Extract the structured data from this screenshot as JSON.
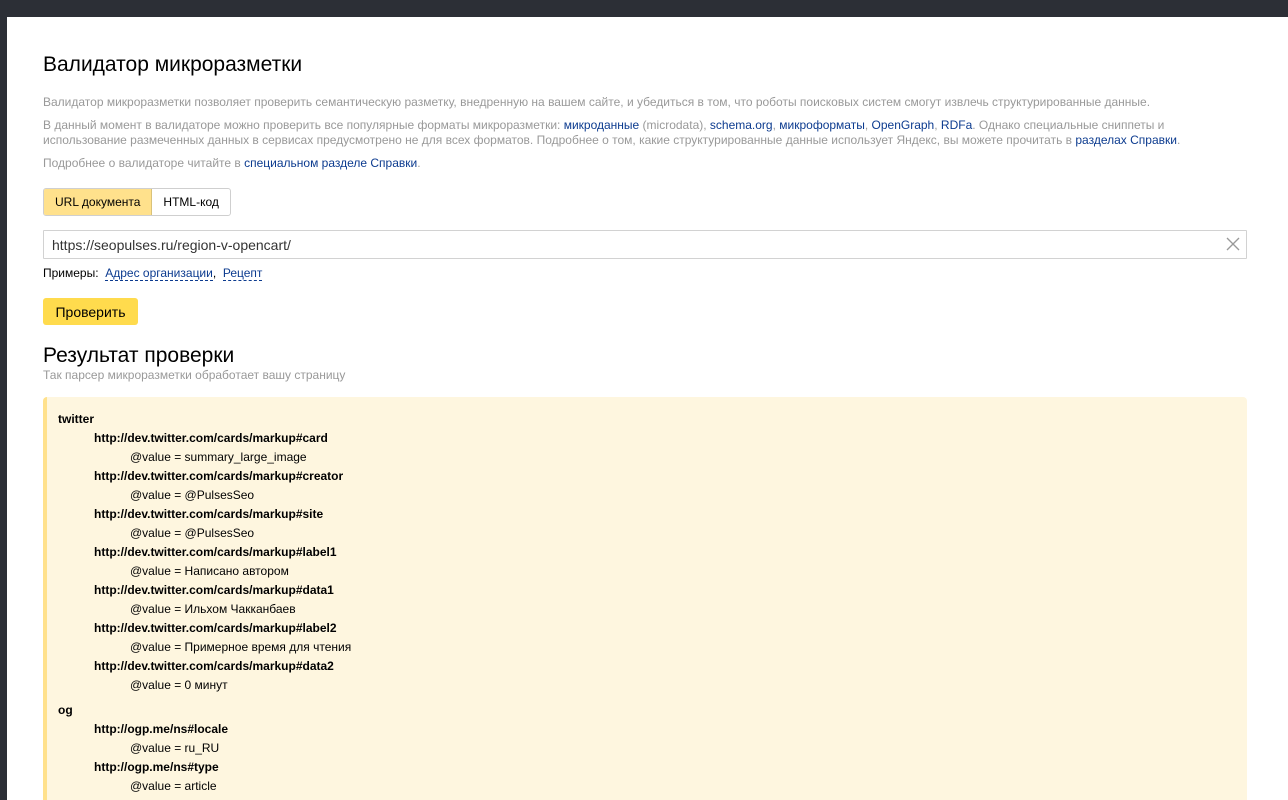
{
  "page": {
    "title": "Валидатор микроразметки",
    "intro": "Валидатор микроразметки позволяет проверить семантическую разметку, внедренную на вашем сайте, и убедиться в том, что роботы поисковых систем смогут извлечь структурированные данные.",
    "formats": {
      "prefix": "В данный момент в валидаторе можно проверить все популярные форматы микроразметки: ",
      "microdata_link": "микроданные",
      "microdata_note": " (microdata), ",
      "schema_link": "schema.org",
      "sep1": ", ",
      "microformats_link": "микроформаты",
      "sep2": ", ",
      "opengraph_link": "OpenGraph",
      "sep3": ", ",
      "rdfa_link": "RDFa",
      "suffix": ". Однако специальные сниппеты и использование размеченных данных в сервисах предусмотрено не для всех форматов. Подробнее о том, какие структурированные данные использует Яндекс, вы можете прочитать в ",
      "help_link": "разделах Справки",
      "end": "."
    },
    "more": {
      "prefix": "Подробнее о валидаторе читайте в ",
      "link": "специальном разделе Справки",
      "end": "."
    }
  },
  "tabs": [
    {
      "label": "URL документа",
      "active": true
    },
    {
      "label": "HTML-код",
      "active": false
    }
  ],
  "url_input": {
    "value": "https://seopulses.ru/region-v-opencart/"
  },
  "examples": {
    "label": "Примеры:",
    "items": [
      "Адрес организации",
      "Рецепт"
    ]
  },
  "check_button": "Проверить",
  "result": {
    "title": "Результат проверки",
    "subtitle": "Так парсер микроразметки обработает вашу страницу",
    "groups": [
      {
        "name": "twitter",
        "props": [
          {
            "key": "http://dev.twitter.com/cards/markup#card",
            "value": "@value = summary_large_image"
          },
          {
            "key": "http://dev.twitter.com/cards/markup#creator",
            "value": "@value = @PulsesSeo"
          },
          {
            "key": "http://dev.twitter.com/cards/markup#site",
            "value": "@value = @PulsesSeo"
          },
          {
            "key": "http://dev.twitter.com/cards/markup#label1",
            "value": "@value = Написано автором"
          },
          {
            "key": "http://dev.twitter.com/cards/markup#data1",
            "value": "@value = Ильхом Чакканбаев"
          },
          {
            "key": "http://dev.twitter.com/cards/markup#label2",
            "value": "@value = Примерное время для чтения"
          },
          {
            "key": "http://dev.twitter.com/cards/markup#data2",
            "value": "@value = 0 минут"
          }
        ]
      },
      {
        "name": "og",
        "props": [
          {
            "key": "http://ogp.me/ns#locale",
            "value": "@value = ru_RU"
          },
          {
            "key": "http://ogp.me/ns#type",
            "value": "@value = article"
          }
        ]
      }
    ]
  },
  "colors": {
    "background": "#2c2f36",
    "accent_yellow": "#ffdb4d",
    "tab_active": "#ffe18c",
    "result_bg": "#fef6df",
    "link": "#0c3b8f"
  }
}
